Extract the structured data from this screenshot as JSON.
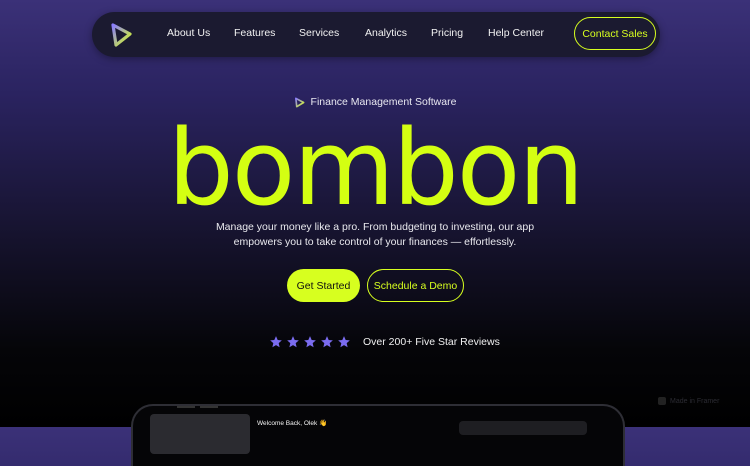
{
  "nav": {
    "logo_icon": "play-triangle-logo-icon",
    "links": [
      "About Us",
      "Features",
      "Services",
      "Analytics",
      "Pricing",
      "Help Center"
    ],
    "contact_label": "Contact Sales"
  },
  "hero": {
    "tagline": "Finance Management Software",
    "brand": "bombon",
    "subtitle_line1": "Manage your money like a pro. From budgeting to investing, our app",
    "subtitle_line2": "empowers you to take control of your finances — effortlessly.",
    "primary_cta": "Get Started",
    "secondary_cta": "Schedule a Demo",
    "rating_stars": 5,
    "rating_text": "Over 200+ Five Star Reviews"
  },
  "preview": {
    "welcome_text": "Welcome Back, Olek 👋"
  },
  "badge": {
    "label": "Made in Framer"
  },
  "colors": {
    "accent": "#d7ff1f",
    "star": "#7b6cf0",
    "nav_bg": "#1b1a30",
    "bg_top": "#3b3178",
    "bg_bottom": "#000000"
  }
}
